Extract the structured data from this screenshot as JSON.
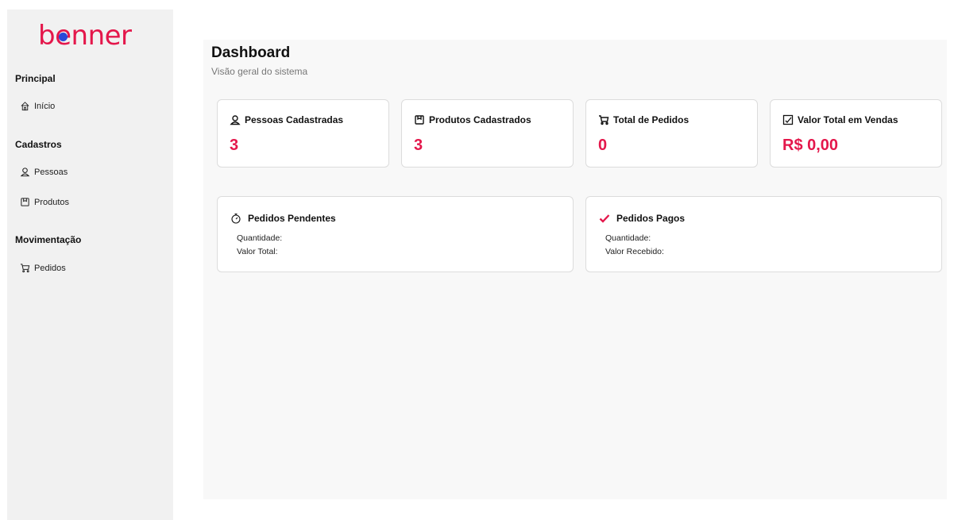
{
  "brand": {
    "logo_text_pre": "b",
    "logo_text_dot": "e",
    "logo_text_post": "nner",
    "accent_color": "#e4174b",
    "dot_color": "#2a49d8"
  },
  "sidebar": {
    "sections": [
      {
        "title": "Principal",
        "items": [
          {
            "label": "Início",
            "icon": "home-icon"
          }
        ]
      },
      {
        "title": "Cadastros",
        "items": [
          {
            "label": "Pessoas",
            "icon": "person-icon"
          },
          {
            "label": "Produtos",
            "icon": "box-icon"
          }
        ]
      },
      {
        "title": "Movimentação",
        "items": [
          {
            "label": "Pedidos",
            "icon": "cart-icon"
          }
        ]
      }
    ]
  },
  "header": {
    "title": "Dashboard",
    "subtitle": "Visão geral do sistema"
  },
  "stats": [
    {
      "label": "Pessoas Cadastradas",
      "value": "3",
      "icon": "person-icon"
    },
    {
      "label": "Produtos Cadastrados",
      "value": "3",
      "icon": "box-icon"
    },
    {
      "label": "Total de Pedidos",
      "value": "0",
      "icon": "cart-icon"
    },
    {
      "label": "Valor Total em Vendas",
      "value": "R$ 0,00",
      "icon": "checkbox-icon"
    }
  ],
  "summaries": [
    {
      "title": "Pedidos Pendentes",
      "icon": "stopwatch-icon",
      "line1": "Quantidade:",
      "line2": "Valor Total:"
    },
    {
      "title": "Pedidos Pagos",
      "icon": "check-icon",
      "line1": "Quantidade:",
      "line2": "Valor Recebido:"
    }
  ]
}
